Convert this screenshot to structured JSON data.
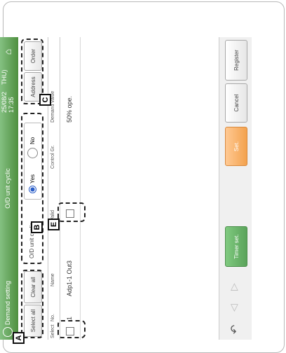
{
  "header": {
    "app_title": "Demand setting",
    "mode_title": "O/D unit cyclic",
    "datetime": "25/08/2",
    "datetime_suffix": "THU) 17:35"
  },
  "toolbar": {
    "select_all": "Select all",
    "clear_all": "Clear all"
  },
  "cyclic": {
    "label": "O/D unit cyclic",
    "yes": "Yes",
    "no": "No"
  },
  "sort": {
    "address": "Address",
    "order": "Order"
  },
  "table": {
    "columns": [
      "Select",
      "No.",
      "Name",
      "Valid",
      "Control Gr.",
      "Demand value"
    ],
    "rows": [
      {
        "no": "1",
        "name": "Adp1-1 Out3",
        "demand": "50% ope."
      }
    ]
  },
  "footer": {
    "timer_set": "Timer set.",
    "set": "Set.",
    "cancel": "Cancel",
    "register": "Register"
  },
  "markers": {
    "a": "A",
    "b": "B",
    "c": "C",
    "e": "E"
  }
}
